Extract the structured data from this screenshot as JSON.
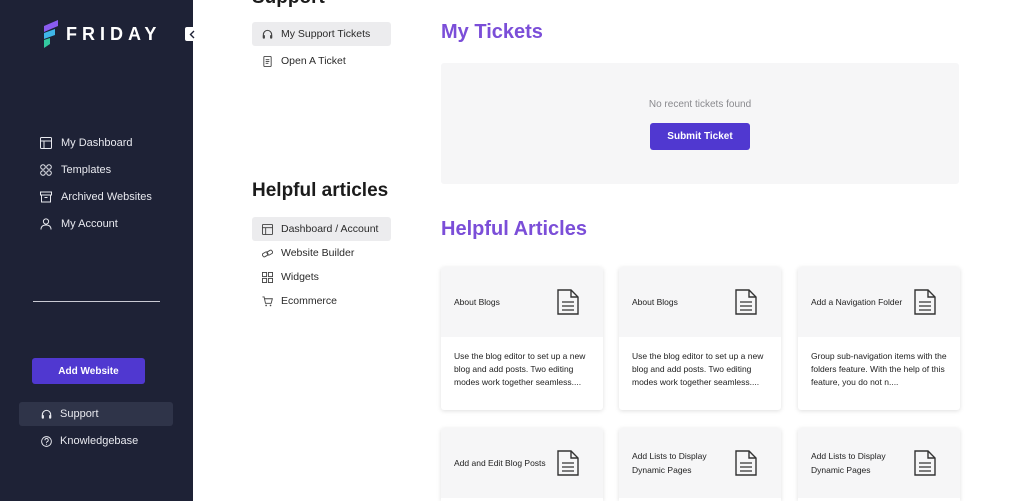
{
  "brand": {
    "name": "FRIDAY"
  },
  "sidebar": {
    "nav": [
      {
        "label": "My Dashboard",
        "icon": "dashboard-icon"
      },
      {
        "label": "Templates",
        "icon": "templates-icon"
      },
      {
        "label": "Archived Websites",
        "icon": "archive-icon"
      },
      {
        "label": "My Account",
        "icon": "user-icon"
      }
    ],
    "add_website": "Add Website",
    "bottom": [
      {
        "label": "Support",
        "icon": "headset-icon",
        "active": true
      },
      {
        "label": "Knowledgebase",
        "icon": "question-circle-icon",
        "active": false
      }
    ]
  },
  "support": {
    "title": "Support",
    "items": [
      {
        "label": "My Support Tickets",
        "icon": "headset-icon",
        "active": true
      },
      {
        "label": "Open A Ticket",
        "icon": "document-icon",
        "active": false
      }
    ]
  },
  "helpful": {
    "title": "Helpful articles",
    "items": [
      {
        "label": "Dashboard / Account",
        "icon": "layout-icon",
        "active": true
      },
      {
        "label": "Website Builder",
        "icon": "builder-icon",
        "active": false
      },
      {
        "label": "Widgets",
        "icon": "widgets-icon",
        "active": false
      },
      {
        "label": "Ecommerce",
        "icon": "cart-icon",
        "active": false
      }
    ]
  },
  "tickets": {
    "heading": "My Tickets",
    "empty_text": "No recent tickets found",
    "submit_label": "Submit Ticket"
  },
  "articles": {
    "heading": "Helpful Articles",
    "cards": [
      {
        "title": "About Blogs",
        "desc": "Use the blog editor to set up a new blog and add posts. Two editing modes work together seamless...."
      },
      {
        "title": "About Blogs",
        "desc": "Use the blog editor to set up a new blog and add posts. Two editing modes work together seamless...."
      },
      {
        "title": "Add a Navigation Folder",
        "desc": "Group sub-navigation items with the folders feature. With the help of this feature, you do not n...."
      },
      {
        "title": "Add and Edit Blog Posts",
        "desc": ""
      },
      {
        "title": "Add Lists to Display Dynamic Pages",
        "desc": ""
      },
      {
        "title": "Add Lists to Display Dynamic Pages",
        "desc": ""
      }
    ]
  },
  "colors": {
    "sidebar": "#1e2236",
    "accent": "#5038d0",
    "heading": "#7b4ed8"
  }
}
